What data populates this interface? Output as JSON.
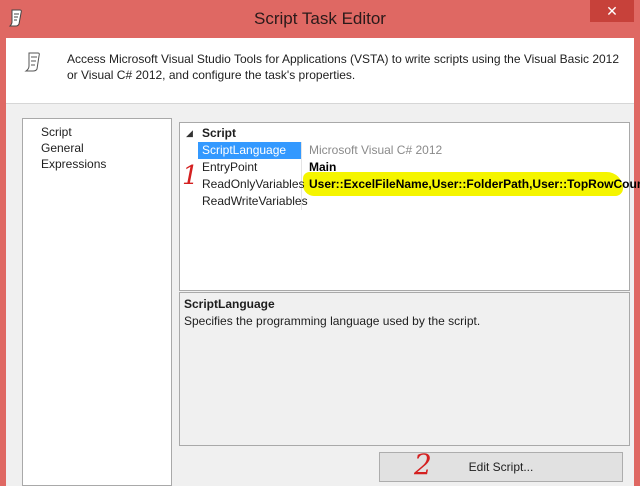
{
  "window": {
    "title": "Script Task Editor",
    "close_glyph": "✕",
    "app_icon": "script-scroll-icon"
  },
  "header": {
    "icon": "script-scroll-icon",
    "description": "Access Microsoft Visual Studio Tools for Applications (VSTA) to write scripts using the Visual Basic 2012 or Visual C# 2012, and configure the task's properties."
  },
  "nav": {
    "items": [
      {
        "label": "Script",
        "selected": true
      },
      {
        "label": "General",
        "selected": false
      },
      {
        "label": "Expressions",
        "selected": false
      }
    ]
  },
  "grid": {
    "category": "Script",
    "category_arrow": "◢",
    "properties": [
      {
        "name": "ScriptLanguage",
        "value": "Microsoft Visual C# 2012",
        "selected": true
      },
      {
        "name": "EntryPoint",
        "value": "Main",
        "selected": false
      },
      {
        "name": "ReadOnlyVariables",
        "value": "User::ExcelFileName,User::FolderPath,User::TopRowCount",
        "selected": false,
        "highlight_color": "#f5f500"
      },
      {
        "name": "ReadWriteVariables",
        "value": "",
        "selected": false
      }
    ]
  },
  "description": {
    "title": "ScriptLanguage",
    "text": "Specifies the programming language used by the script."
  },
  "buttons": {
    "edit_script": "Edit Script..."
  },
  "annotations": {
    "mark_1": "1",
    "mark_2": "2",
    "color": "#d42020"
  },
  "colors": {
    "titlebar": "#df6863",
    "selection": "#3399ff"
  }
}
